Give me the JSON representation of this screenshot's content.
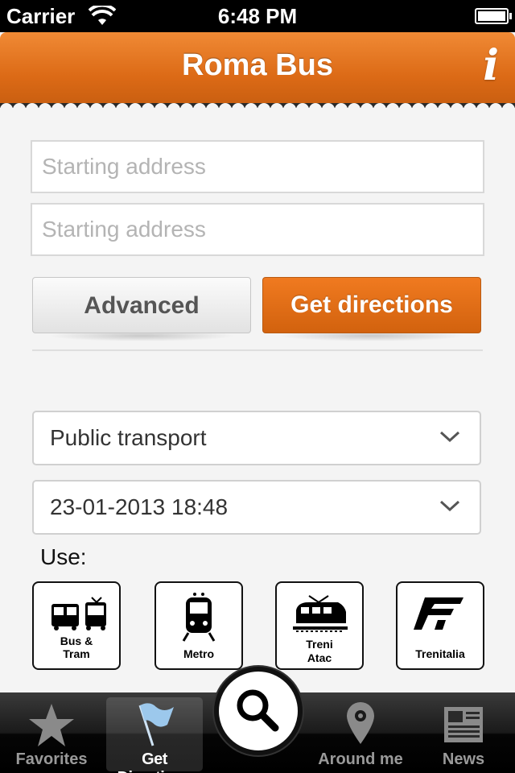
{
  "status_bar": {
    "carrier": "Carrier",
    "time": "6:48 PM"
  },
  "header": {
    "title": "Roma Bus",
    "info_glyph": "i",
    "colors": {
      "accent": "#e07020"
    }
  },
  "form": {
    "start_placeholder": "Starting address",
    "end_placeholder": "Starting address",
    "advanced_label": "Advanced",
    "directions_label": "Get directions",
    "mode_select": "Public transport",
    "datetime_select": "23-01-2013 18:48",
    "use_label": "Use:",
    "modes": [
      {
        "line1": "Bus &",
        "line2": "Tram",
        "icon": "bus-tram-icon"
      },
      {
        "line1": "Metro",
        "icon": "metro-icon"
      },
      {
        "line1": "Treni",
        "line2": "Atac",
        "icon": "train-icon"
      },
      {
        "line1": "Trenitalia",
        "icon": "trenitalia-logo-icon"
      }
    ]
  },
  "tabbar": {
    "items": [
      {
        "label": "Favorites",
        "icon": "star-icon"
      },
      {
        "label": "Get Directions",
        "icon": "flag-icon",
        "active": true
      },
      {
        "label": "",
        "icon": "search-icon"
      },
      {
        "label": "Around me",
        "icon": "map-pin-icon"
      },
      {
        "label": "News",
        "icon": "newspaper-icon"
      }
    ]
  }
}
